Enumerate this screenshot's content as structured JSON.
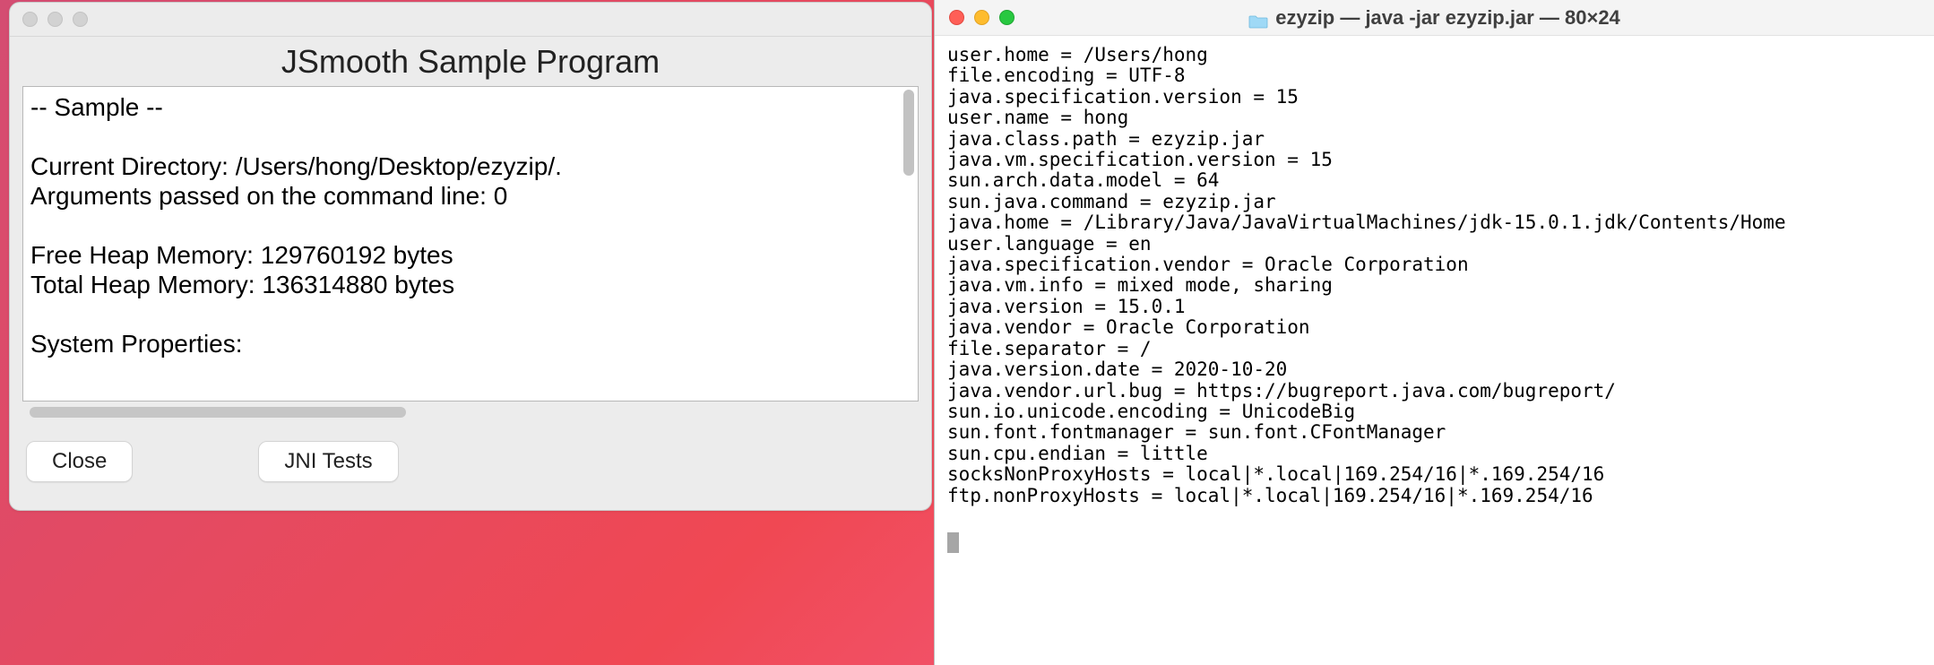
{
  "left_window": {
    "title": "JSmooth Sample Program",
    "text_lines": [
      "-- Sample --",
      "",
      "Current Directory: /Users/hong/Desktop/ezyzip/.",
      "Arguments passed on the command line: 0",
      "",
      "Free Heap Memory: 129760192 bytes",
      "Total Heap Memory: 136314880 bytes",
      "",
      "System Properties:"
    ],
    "buttons": {
      "close": "Close",
      "jni": "JNI Tests"
    }
  },
  "terminal": {
    "title": "ezyzip — java -jar ezyzip.jar — 80×24",
    "lines": [
      "user.home = /Users/hong",
      "file.encoding = UTF-8",
      "java.specification.version = 15",
      "user.name = hong",
      "java.class.path = ezyzip.jar",
      "java.vm.specification.version = 15",
      "sun.arch.data.model = 64",
      "sun.java.command = ezyzip.jar",
      "java.home = /Library/Java/JavaVirtualMachines/jdk-15.0.1.jdk/Contents/Home",
      "user.language = en",
      "java.specification.vendor = Oracle Corporation",
      "java.vm.info = mixed mode, sharing",
      "java.version = 15.0.1",
      "java.vendor = Oracle Corporation",
      "file.separator = /",
      "java.version.date = 2020-10-20",
      "java.vendor.url.bug = https://bugreport.java.com/bugreport/",
      "sun.io.unicode.encoding = UnicodeBig",
      "sun.font.fontmanager = sun.font.CFontManager",
      "sun.cpu.endian = little",
      "socksNonProxyHosts = local|*.local|169.254/16|*.169.254/16",
      "ftp.nonProxyHosts = local|*.local|169.254/16|*.169.254/16"
    ]
  }
}
